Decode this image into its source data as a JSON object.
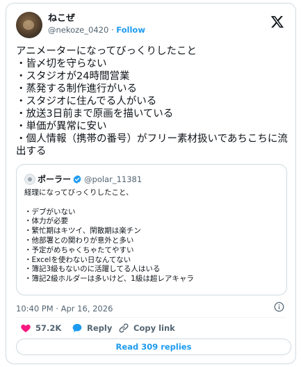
{
  "author": {
    "display_name": "ねこぜ",
    "handle": "@nekoze_0420",
    "separator": " · ",
    "follow_label": "Follow"
  },
  "tweet": {
    "text": "アニメーターになってびっくりしたこと\n・皆〆切を守らない\n・スタジオが24時間営業\n・蒸発する制作進行がいる\n・スタジオに住んでる人がいる\n・放送3日前まで原画を描いている\n・単価が異常に安い\n・個人情報（携帯の番号）がフリー素材扱いであちこちに流出する"
  },
  "quote": {
    "display_name": "ポーラー",
    "handle": "@polar_11381",
    "text": "経理になってびっくりしたこと、\n\n・デブがいない\n・体力が必要\n・繁忙期はキツイ、閑散期は楽チン\n・他部署との関わりが意外と多い\n・予定がめちゃくちゃたてやすい\n・Excelを使わない日なんてない\n・簿記3級もないのに活躍してる人はいる\n・簿記2級ホルダーは多いけど、1級は超レアキャラ"
  },
  "meta": {
    "timestamp": "10:40 PM · Apr 16, 2026"
  },
  "actions": {
    "likes": "57.2K",
    "reply_label": "Reply",
    "copy_link_label": "Copy link"
  },
  "read_replies_label": "Read 309 replies",
  "colors": {
    "accent": "#1d9bf0",
    "like": "#f91880",
    "muted": "#536471",
    "border": "#cfd9de"
  },
  "icons": [
    "x-logo-icon",
    "verified-badge-icon",
    "info-icon",
    "heart-icon",
    "reply-bubble-icon",
    "link-icon"
  ]
}
